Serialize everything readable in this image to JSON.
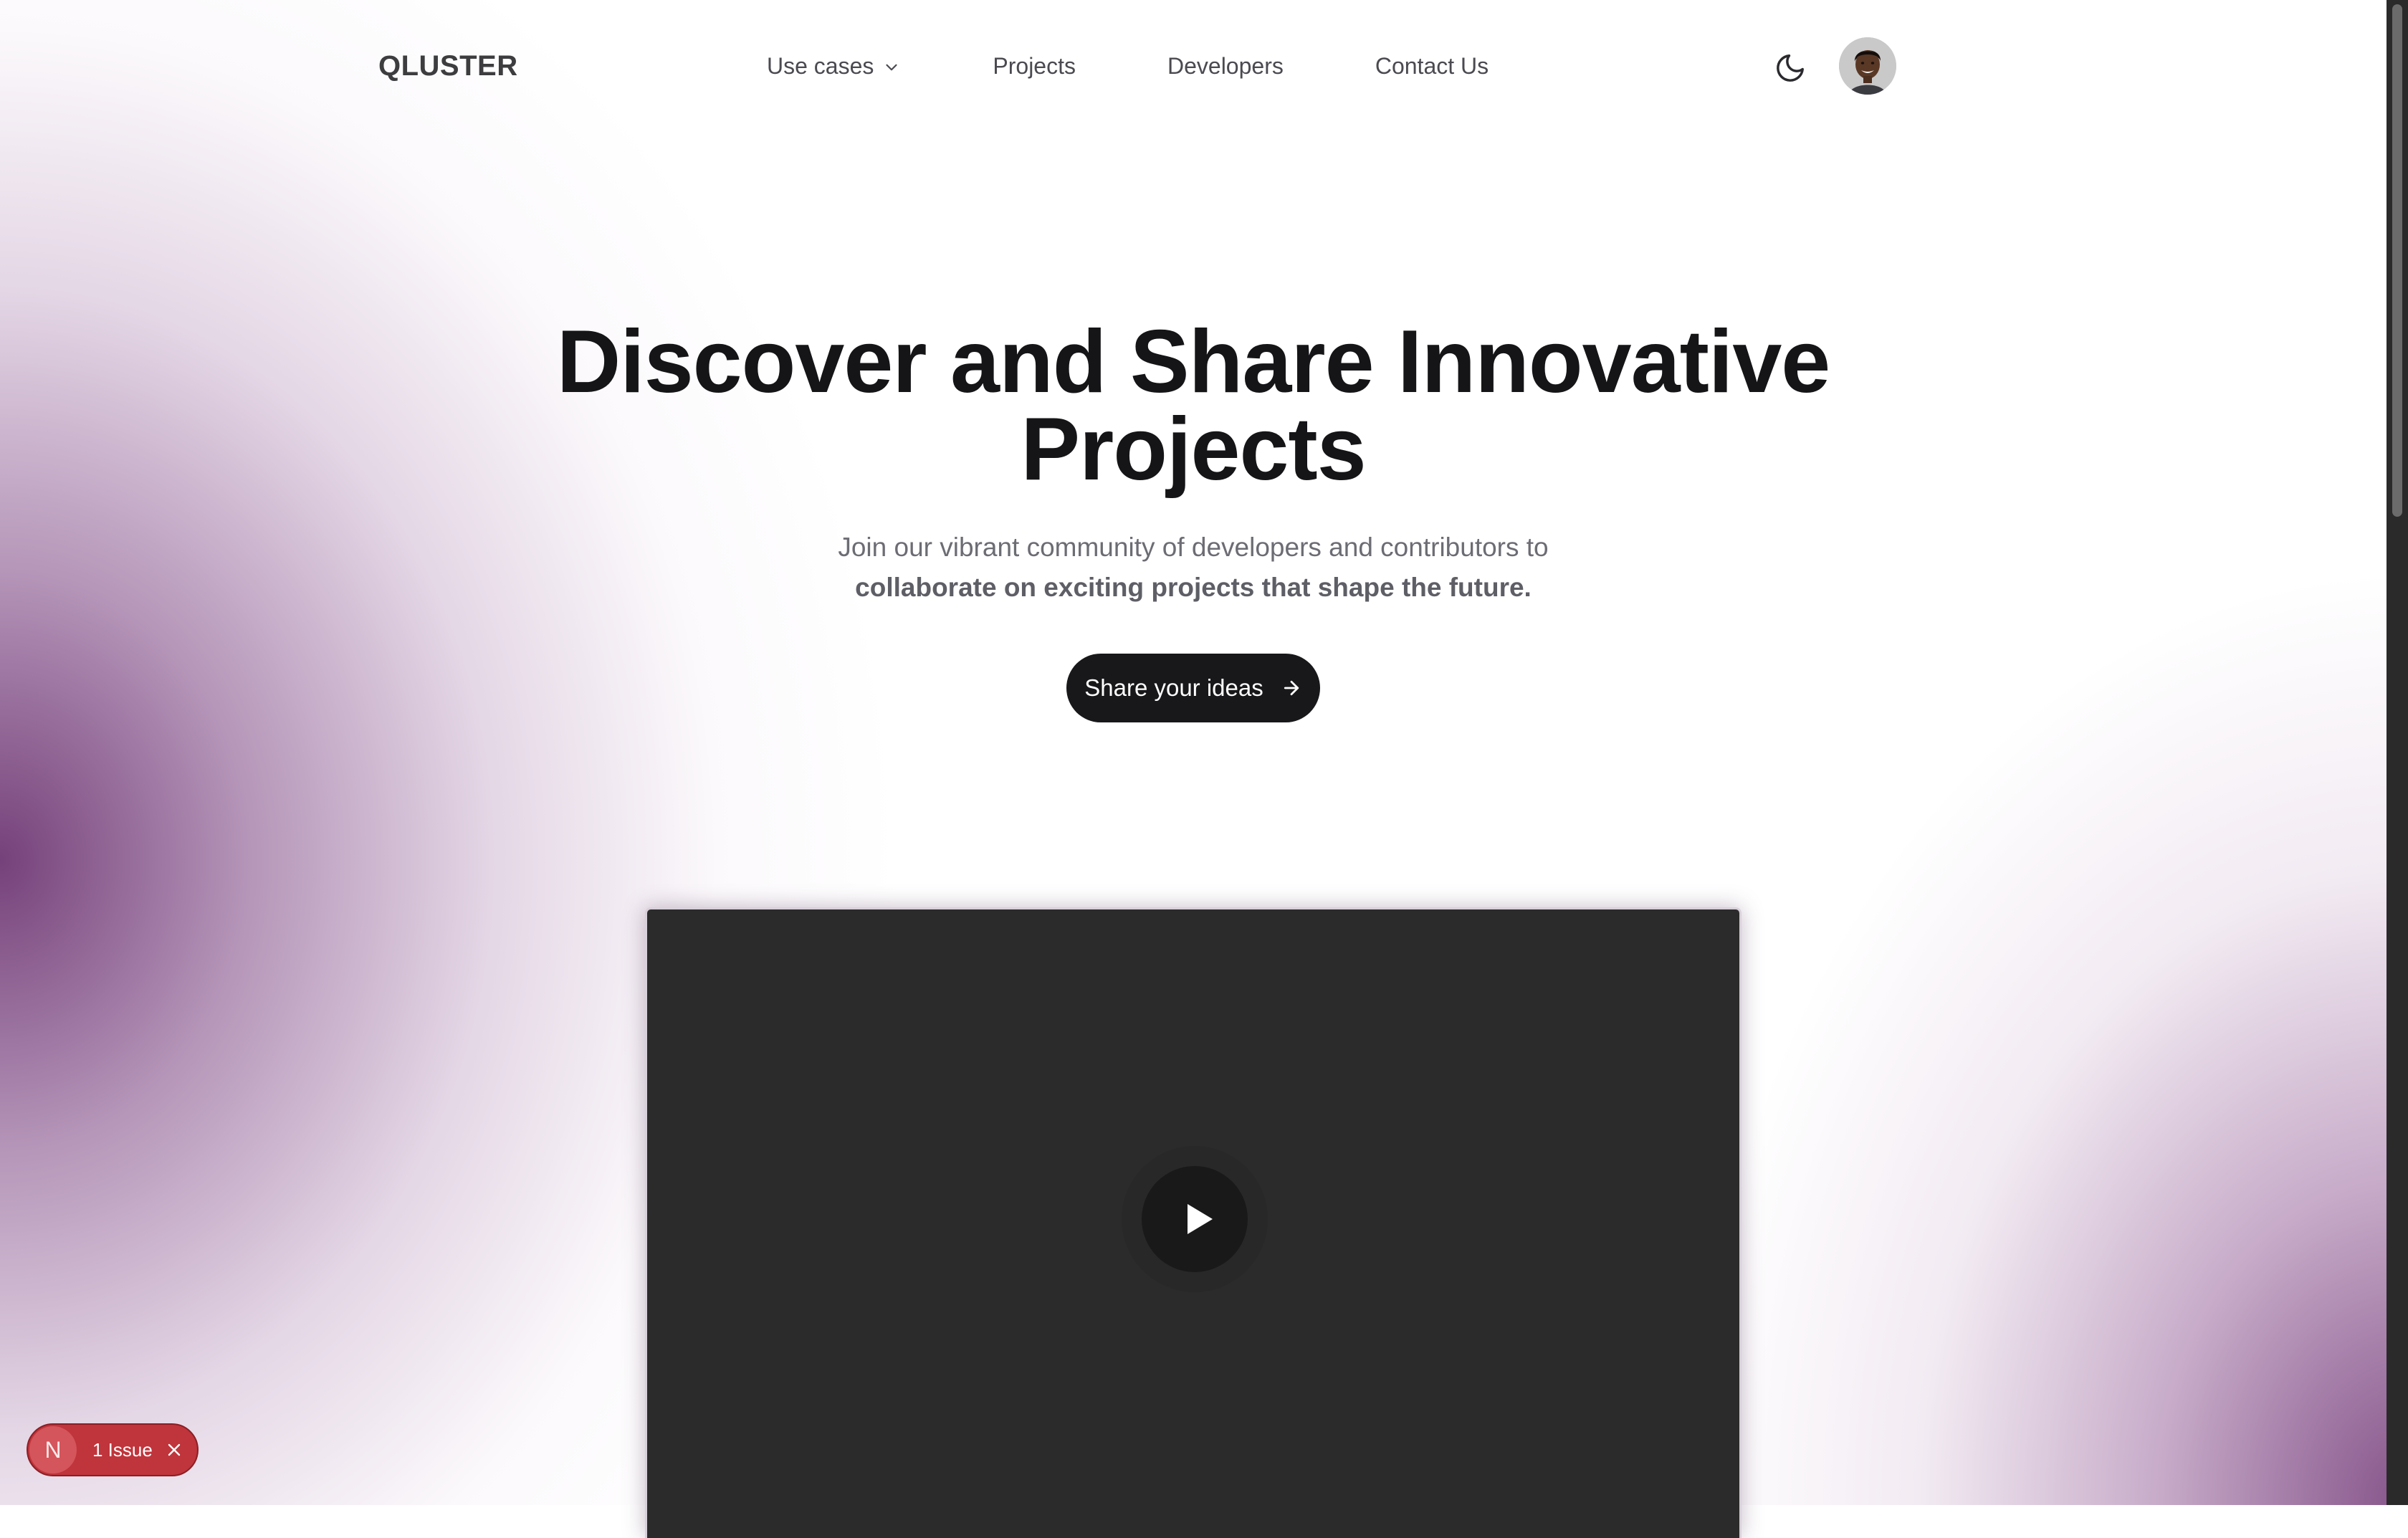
{
  "brand": {
    "logo": "QLUSTER"
  },
  "nav": {
    "links": [
      {
        "label": "Use cases",
        "has_dropdown": true
      },
      {
        "label": "Projects"
      },
      {
        "label": "Developers"
      },
      {
        "label": "Contact Us"
      }
    ],
    "theme_toggle_icon": "moon-icon",
    "avatar_icon": "user-avatar"
  },
  "hero": {
    "title_line1": "Discover and Share Innovative",
    "title_line2": "Projects",
    "subtitle_line1": "Join our vibrant community of developers and contributors to",
    "subtitle_line2": "collaborate on exciting projects that shape the future.",
    "cta_label": "Share your ideas",
    "cta_icon": "arrow-right-icon"
  },
  "video": {
    "play_icon": "play-icon"
  },
  "dev_indicator": {
    "logo_letter": "N",
    "label": "1 Issue",
    "close_icon": "close-icon"
  },
  "colors": {
    "accent_purple": "#7a4a80",
    "cta_bg": "#18181b",
    "video_bg": "#2b2b2b",
    "issue_red": "#c0343b"
  }
}
